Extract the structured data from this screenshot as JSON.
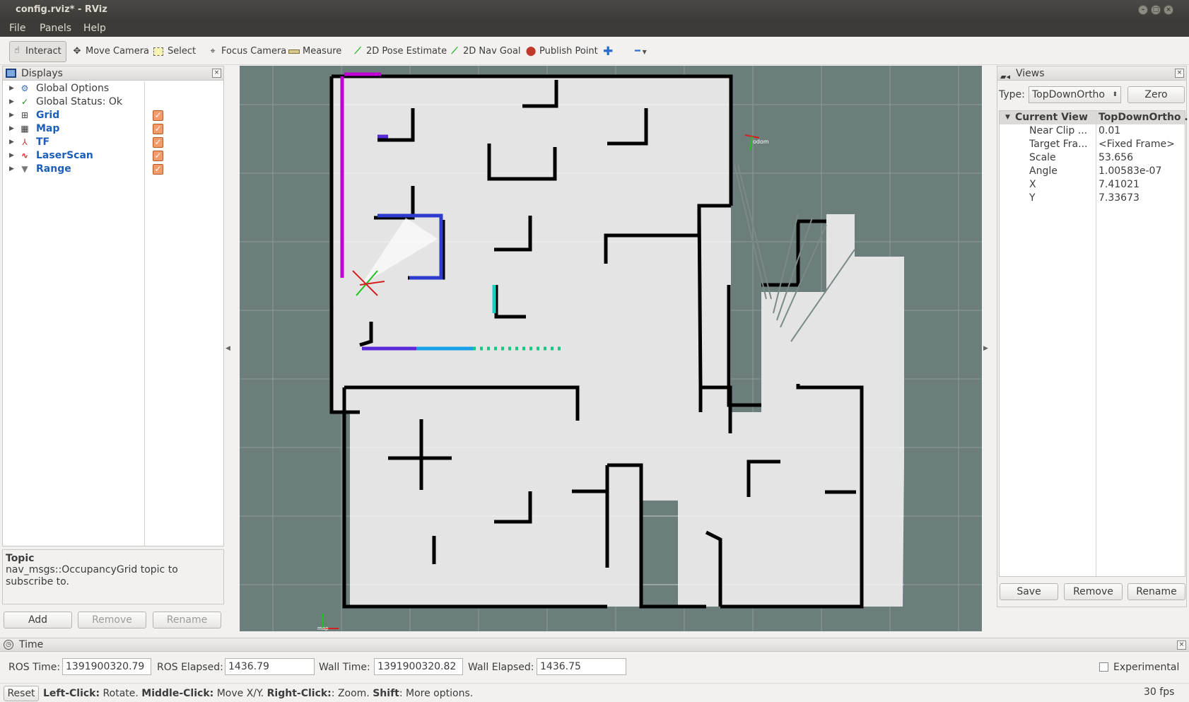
{
  "window": {
    "title": "config.rviz* - RViz"
  },
  "menu": {
    "file": "File",
    "panels": "Panels",
    "help": "Help"
  },
  "toolbar": {
    "interact": "Interact",
    "move_camera": "Move Camera",
    "select": "Select",
    "focus_camera": "Focus Camera",
    "measure": "Measure",
    "pose_estimate": "2D Pose Estimate",
    "nav_goal": "2D Nav Goal",
    "publish_point": "Publish Point"
  },
  "displays": {
    "title": "Displays",
    "items": [
      {
        "label": "Global Options"
      },
      {
        "label": "Global Status: Ok"
      },
      {
        "label": "Grid"
      },
      {
        "label": "Map"
      },
      {
        "label": "TF"
      },
      {
        "label": "LaserScan"
      },
      {
        "label": "Range"
      }
    ],
    "desc_title": "Topic",
    "desc_text": "nav_msgs::OccupancyGrid topic to subscribe to.",
    "add": "Add",
    "remove": "Remove",
    "rename": "Rename"
  },
  "views": {
    "title": "Views",
    "type_label": "Type:",
    "type_value": "TopDownOrtho",
    "zero": "Zero",
    "current_view_label": "Current View",
    "current_view_value": "TopDownOrtho ...",
    "props": [
      {
        "k": "Near Clip ...",
        "v": "0.01"
      },
      {
        "k": "Target Fra...",
        "v": "<Fixed Frame>"
      },
      {
        "k": "Scale",
        "v": "53.656"
      },
      {
        "k": "Angle",
        "v": "1.00583e-07"
      },
      {
        "k": "X",
        "v": "7.41021"
      },
      {
        "k": "Y",
        "v": "7.33673"
      }
    ],
    "save": "Save",
    "remove": "Remove",
    "rename": "Rename"
  },
  "viewport": {
    "odom_label": "odom",
    "map_label": "map"
  },
  "time": {
    "title": "Time",
    "ros_time_label": "ROS Time:",
    "ros_time": "1391900320.79",
    "ros_elapsed_label": "ROS Elapsed:",
    "ros_elapsed": "1436.79",
    "wall_time_label": "Wall Time:",
    "wall_time": "1391900320.82",
    "wall_elapsed_label": "Wall Elapsed:",
    "wall_elapsed": "1436.75",
    "experimental": "Experimental"
  },
  "status": {
    "reset": "Reset",
    "lc": "Left-Click:",
    "lc_t": " Rotate. ",
    "mc": "Middle-Click:",
    "mc_t": " Move X/Y. ",
    "rc": "Right-Click:",
    "rc_t": ": Zoom. ",
    "sh": "Shift",
    "sh_t": ": More options.",
    "fps": "30 fps"
  },
  "colors": {
    "viewport_bg": "#6b7e7c",
    "free_space": "#e4e4e4",
    "wall": "#000000",
    "checkbox": "#f39c6b"
  }
}
